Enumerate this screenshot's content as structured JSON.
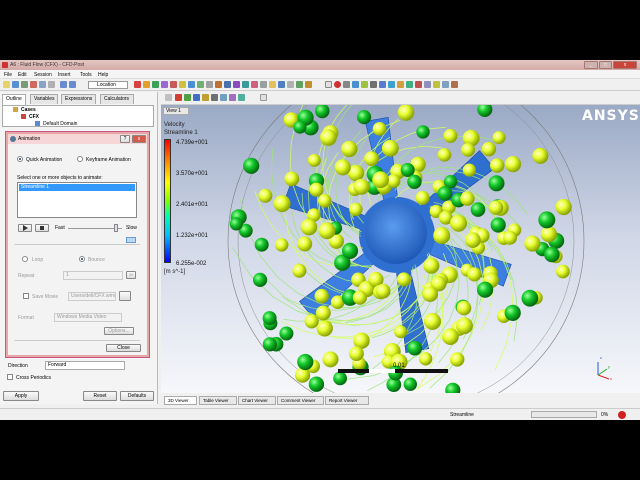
{
  "window": {
    "title": "A6 : Fluid Flow (CFX) - CFD-Post",
    "controls": [
      "_",
      "□",
      "x"
    ]
  },
  "menu": [
    "File",
    "Edit",
    "Session",
    "Insert",
    "Tools",
    "Help"
  ],
  "toolbar": {
    "location_label": "Location"
  },
  "left_panel": {
    "tabs": [
      "Outline",
      "Variables",
      "Expressions",
      "Calculators"
    ],
    "tree": {
      "root": "Cases",
      "child": "CFX",
      "leaf": "Default Domain"
    },
    "direction_label": "Direction",
    "direction_value": "Forward",
    "cross_periodics_label": "Cross Periodics",
    "apply_label": "Apply",
    "reset_label": "Reset",
    "defaults_label": "Defaults"
  },
  "animation_dialog": {
    "title": "Animation",
    "close_glyph": "x",
    "help_glyph": "?",
    "quick_animation_label": "Quick Animation",
    "keyframe_animation_label": "Keyframe Animation",
    "select_prompt": "Select one or more objects to animate:",
    "list_items": [
      "Streamline 1"
    ],
    "fast_label": "Fast",
    "slow_label": "Slow",
    "loop_label": "Loop",
    "bounce_label": "Bounce",
    "repeat_label": "Repeat",
    "repeat_value": "1",
    "repeat_infinity": "∞",
    "save_movie_label": "Save Movie",
    "movie_path": "Users/dell/CFX.wmv",
    "format_label": "Format",
    "format_value": "Windows Media Video",
    "options_label": "Options...",
    "close_label": "Close"
  },
  "viewer": {
    "view_label": "View 1",
    "brand": "ANSYS",
    "legend": {
      "variable": "Velocity",
      "object": "Streamline 1",
      "values": [
        "4.739e+001",
        "3.570e+001",
        "2.401e+001",
        "1.232e+001",
        "6.255e-002"
      ],
      "unit": "[m s^-1]"
    },
    "scale_label": "0.01",
    "axis_labels": [
      "x",
      "y",
      "z"
    ],
    "tabs": [
      "3D Viewer",
      "Table Viewer",
      "Chart Viewer",
      "Comment Viewer",
      "Report Viewer"
    ]
  },
  "status": {
    "text": "Streamline",
    "progress_text": "0%",
    "progress": 0
  },
  "colors": {
    "accent": "#3399ff",
    "spheres_light": "#e8ff30",
    "spheres_dark": "#0aa01e",
    "blade": "#2f6fd0"
  }
}
